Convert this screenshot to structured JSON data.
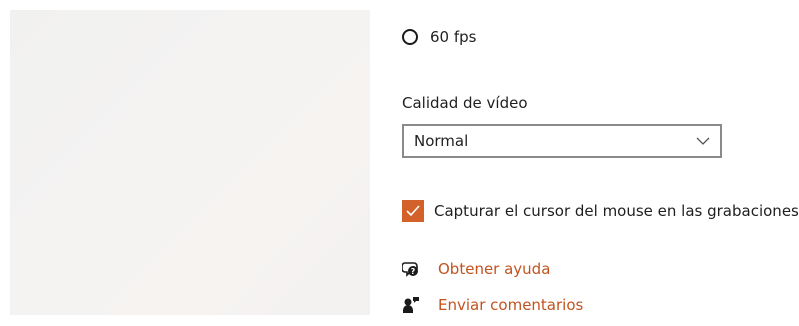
{
  "frame_rate": {
    "option_label": "60 fps",
    "selected": false
  },
  "video_quality": {
    "label": "Calidad de vídeo",
    "selected_value": "Normal"
  },
  "capture_cursor": {
    "label": "Capturar el cursor del mouse en las grabaciones",
    "checked": true
  },
  "links": {
    "help": "Obtener ayuda",
    "feedback": "Enviar comentarios"
  },
  "colors": {
    "accent": "#d2622a",
    "link": "#c1531f",
    "text": "#1f1f1f",
    "border": "#8a8a8a"
  },
  "icons": {
    "help": "help-chat-icon",
    "feedback": "feedback-person-icon",
    "chevron": "chevron-down-icon",
    "check": "checkmark-icon"
  }
}
